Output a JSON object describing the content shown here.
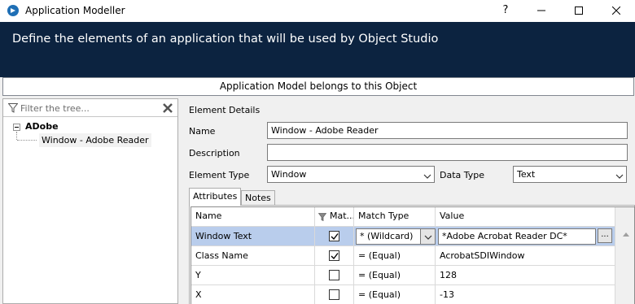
{
  "window": {
    "title": "Application Modeller",
    "help": "?",
    "icon": "blueprism-app-icon"
  },
  "banner": {
    "text": "Define the elements of an application that will be used by Object Studio"
  },
  "subheader": "Application Model belongs to this Object",
  "tree": {
    "filter_placeholder": "Filter the tree...",
    "root": "ADobe",
    "child": "Window - Adobe Reader"
  },
  "details": {
    "section": "Element Details",
    "name_label": "Name",
    "name_value": "Window - Adobe Reader",
    "description_label": "Description",
    "description_value": "",
    "element_type_label": "Element Type",
    "element_type_value": "Window",
    "data_type_label": "Data Type",
    "data_type_value": "Text"
  },
  "tabs": {
    "attributes": "Attributes",
    "notes": "Notes"
  },
  "grid": {
    "headers": [
      "Name",
      "Mat...",
      "Match Type",
      "Value"
    ],
    "rows": [
      {
        "name": "Window Text",
        "match": true,
        "match_type": "*  (Wildcard)",
        "value": "*Adobe Acrobat Reader DC*"
      },
      {
        "name": "Class Name",
        "match": true,
        "match_type": "=  (Equal)",
        "value": "AcrobatSDIWindow"
      },
      {
        "name": "Y",
        "match": false,
        "match_type": "=  (Equal)",
        "value": "128"
      },
      {
        "name": "X",
        "match": false,
        "match_type": "=  (Equal)",
        "value": "-13"
      }
    ],
    "ellipsis": "..."
  },
  "colors": {
    "banner": "#0c2340",
    "selected_row": "#b9cdec"
  }
}
